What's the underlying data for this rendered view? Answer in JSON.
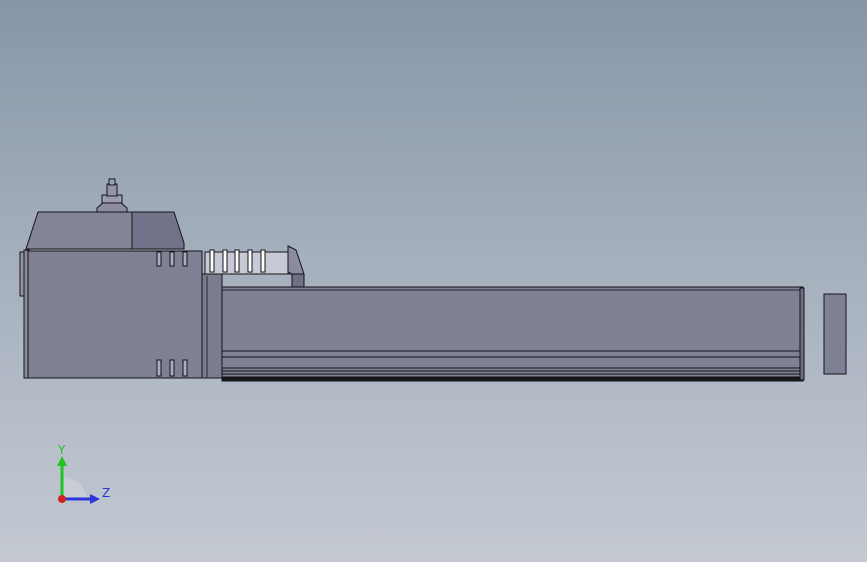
{
  "triad": {
    "y_label": "Y",
    "z_label": "Z",
    "y_color": "#1ec51e",
    "z_color": "#2b35d8",
    "x_color": "#d42020"
  },
  "model": {
    "body_color": "#7f8092",
    "body_dark": "#6e7082",
    "edge_color": "#141418"
  }
}
